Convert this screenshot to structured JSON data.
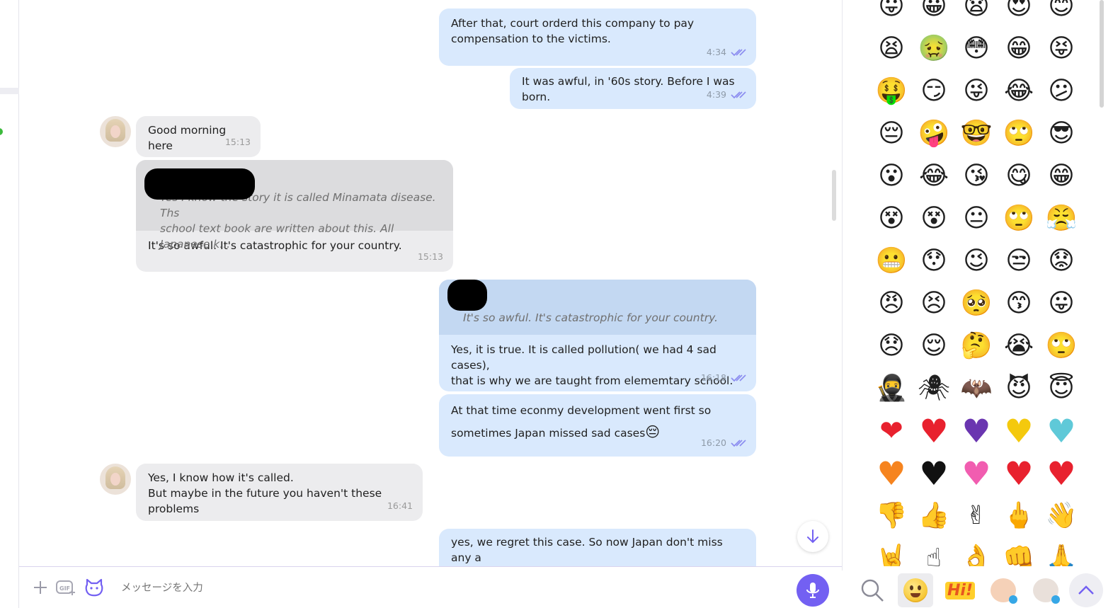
{
  "messages": [
    {
      "dir": "out",
      "text": "After that, court orderd this company to pay\ncompensation to the victims.",
      "time": "4:34",
      "read": true
    },
    {
      "dir": "out",
      "text": "It was awful, in '60s story. Before I was born.",
      "time": "4:39",
      "read": true
    },
    {
      "dir": "in",
      "text": "Good morning here",
      "time": "15:13"
    },
    {
      "dir": "in",
      "quote": "Yes I know the story it is called Minamata disease. Ths\nschool text book are written about this. All Japanese k...",
      "text": "It's so awful. It's catastrophic for your country.",
      "time": "15:13"
    },
    {
      "dir": "out",
      "quote": "It's so awful. It's catastrophic for your country.",
      "text": "Yes, it is true. It is called pollution( we had 4 sad cases),\nthat is why we are taught from elememtary school.",
      "time": "16:18",
      "read": true
    },
    {
      "dir": "out",
      "text": "At that time econmy development went first so\nsometimes Japan missed sad cases",
      "emoji": "😔",
      "time": "16:20",
      "read": true
    },
    {
      "dir": "in",
      "text": "Yes, I know how it's called.\nBut maybe in the future you haven't these problems",
      "time": "16:41"
    },
    {
      "dir": "out",
      "text": "yes, we regret this case. So now Japan don't miss any a\nsingle case now.",
      "time": ""
    }
  ],
  "input": {
    "placeholder": "メッセージを入力"
  },
  "icons": {
    "attach": "plus-icon",
    "gif": "gif-icon",
    "sticker": "sticker-icon",
    "mic": "microphone-icon",
    "scroll_down": "arrow-down-icon"
  },
  "colors": {
    "outgoing": "#d9e9fd",
    "incoming": "#ececee",
    "accent": "#7360f2",
    "tick": "#8c8df0"
  },
  "emoji_rows": [
    [
      "😛",
      "😀",
      "😧",
      "😍",
      "😊"
    ],
    [
      "😫",
      "🤢",
      "😳",
      "😁",
      "😝"
    ],
    [
      "🤑",
      "😏",
      "😜",
      "😂",
      "😕"
    ],
    [
      "😔",
      "🤪",
      "🤓",
      "🙄",
      "😎"
    ],
    [
      "😮",
      "😂",
      "😘",
      "😋",
      "😁"
    ],
    [
      "😵",
      "😵",
      "😐",
      "🙄",
      "😤"
    ],
    [
      "😬",
      "😯",
      "😉",
      "😒",
      "😟"
    ],
    [
      "😠",
      "😣",
      "🥺",
      "😙",
      "😛"
    ],
    [
      "😞",
      "😌",
      "🤔",
      "😭",
      "🙄"
    ],
    [
      "🥷",
      "🕷",
      "🦇",
      "😈",
      "😇"
    ],
    [
      "❤",
      "💔",
      "💜",
      "💛",
      "🩵"
    ],
    [
      "🧡",
      "🖤",
      "💞",
      "💘",
      "💕"
    ],
    [
      "👎",
      "👍",
      "✌",
      "🖕",
      "👋"
    ],
    [
      "🤘",
      "☝",
      "👌",
      "👊",
      "🙏"
    ]
  ],
  "tabs": [
    {
      "name": "search-tab",
      "icon": "search-icon"
    },
    {
      "name": "emoji-tab",
      "icon": "smiley-icon",
      "active": true
    },
    {
      "name": "hi-sticker-tab",
      "label": "Hi!"
    },
    {
      "name": "sticker-pack-tab",
      "icon": "sticker-icon"
    },
    {
      "name": "sticker-pack-2-tab",
      "icon": "sticker-icon"
    },
    {
      "name": "expand-tab",
      "icon": "chevron-up-icon"
    }
  ]
}
